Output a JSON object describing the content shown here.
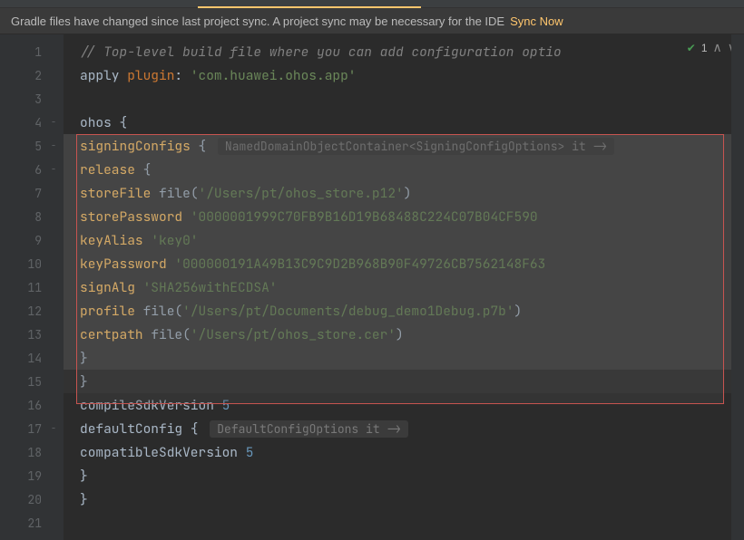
{
  "notif": {
    "message": "Gradle files have changed since last project sync. A project sync may be necessary for the IDE",
    "action": "Sync Now"
  },
  "topIcons": {
    "count": "1"
  },
  "code": {
    "l1_comment": "// Top-level build file where you can add configuration optio",
    "l2_apply": "apply",
    "l2_plugin": "plugin",
    "l2_val": "'com.huawei.ohos.app'",
    "l4_ohos": "ohos",
    "l5_signing": "signingConfigs",
    "l5_hint": "NamedDomainObjectContainer<SigningConfigOptions> it ->",
    "l6_release": "release",
    "l7_storeFile": "storeFile",
    "l7_file": "file",
    "l7_val": "'/Users/pt/ohos_store.p12'",
    "l8_storePassword": "storePassword",
    "l8_val": "'0000001999C70FB9B16D19B68488C224C07B04CF590",
    "l9_keyAlias": "keyAlias",
    "l9_val": "'key0'",
    "l10_keyPassword": "keyPassword",
    "l10_val": "'000000191A49B13C9C9D2B968B90F49726CB7562148F63",
    "l11_signAlg": "signAlg",
    "l11_val": "'SHA256withECDSA'",
    "l12_profile": "profile",
    "l12_file": "file",
    "l12_val": "'/Users/pt/Documents/debug_demo1Debug.p7b'",
    "l13_certpath": "certpath",
    "l13_file": "file",
    "l13_val": "'/Users/pt/ohos_store.cer'",
    "l16_compileSdk": "compileSdkVersion",
    "l16_val": "5",
    "l17_defaultConfig": "defaultConfig",
    "l17_hint": "DefaultConfigOptions it ->",
    "l18_compat": "compatibleSdkVersion",
    "l18_val": "5"
  },
  "lineNumbers": [
    "1",
    "2",
    "3",
    "4",
    "5",
    "6",
    "7",
    "8",
    "9",
    "10",
    "11",
    "12",
    "13",
    "14",
    "15",
    "16",
    "17",
    "18",
    "19",
    "20",
    "21"
  ]
}
